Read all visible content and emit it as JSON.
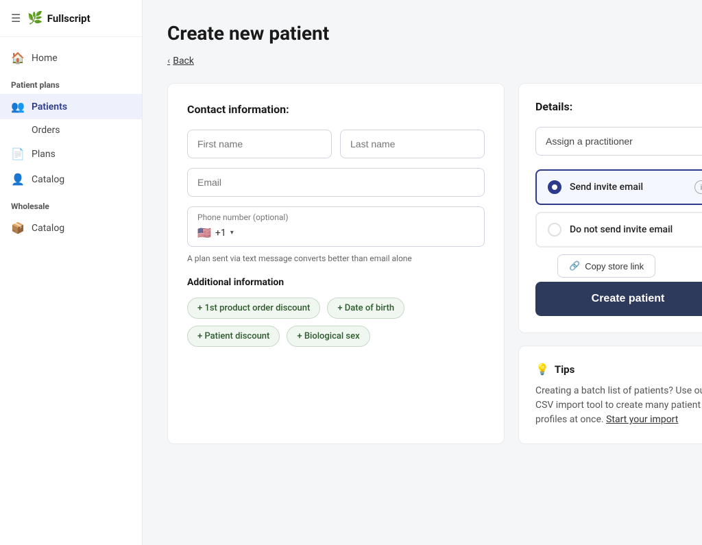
{
  "app": {
    "logo_text": "Fullscript",
    "logo_icon": "🌿"
  },
  "sidebar": {
    "home_label": "Home",
    "patient_plans_label": "Patient plans",
    "patients_label": "Patients",
    "orders_label": "Orders",
    "plans_label": "Plans",
    "catalog_patient_label": "Catalog",
    "wholesale_label": "Wholesale",
    "catalog_wholesale_label": "Catalog"
  },
  "page": {
    "title": "Create new patient",
    "back_label": "Back"
  },
  "contact_form": {
    "section_title": "Contact information:",
    "first_name_placeholder": "First name",
    "last_name_placeholder": "Last name",
    "email_placeholder": "Email",
    "phone_label": "Phone number (optional)",
    "phone_flag": "🇺🇸",
    "phone_code": "+1",
    "phone_hint": "A plan sent via text message converts better than email alone",
    "additional_info_title": "Additional information",
    "tag1": "+ 1st product order discount",
    "tag2": "+ Date of birth",
    "tag3": "+ Patient discount",
    "tag4": "+ Biological sex"
  },
  "details": {
    "section_title": "Details:",
    "assign_practitioner_placeholder": "Assign a practitioner",
    "send_invite_label": "Send invite email",
    "no_invite_label": "Do not send invite email",
    "copy_store_label": "Copy store link"
  },
  "actions": {
    "create_patient_label": "Create patient"
  },
  "tips": {
    "title": "Tips",
    "text": "Creating a batch list of patients? Use our CSV import tool to create many patient profiles at once.",
    "link_text": "Start your import"
  }
}
